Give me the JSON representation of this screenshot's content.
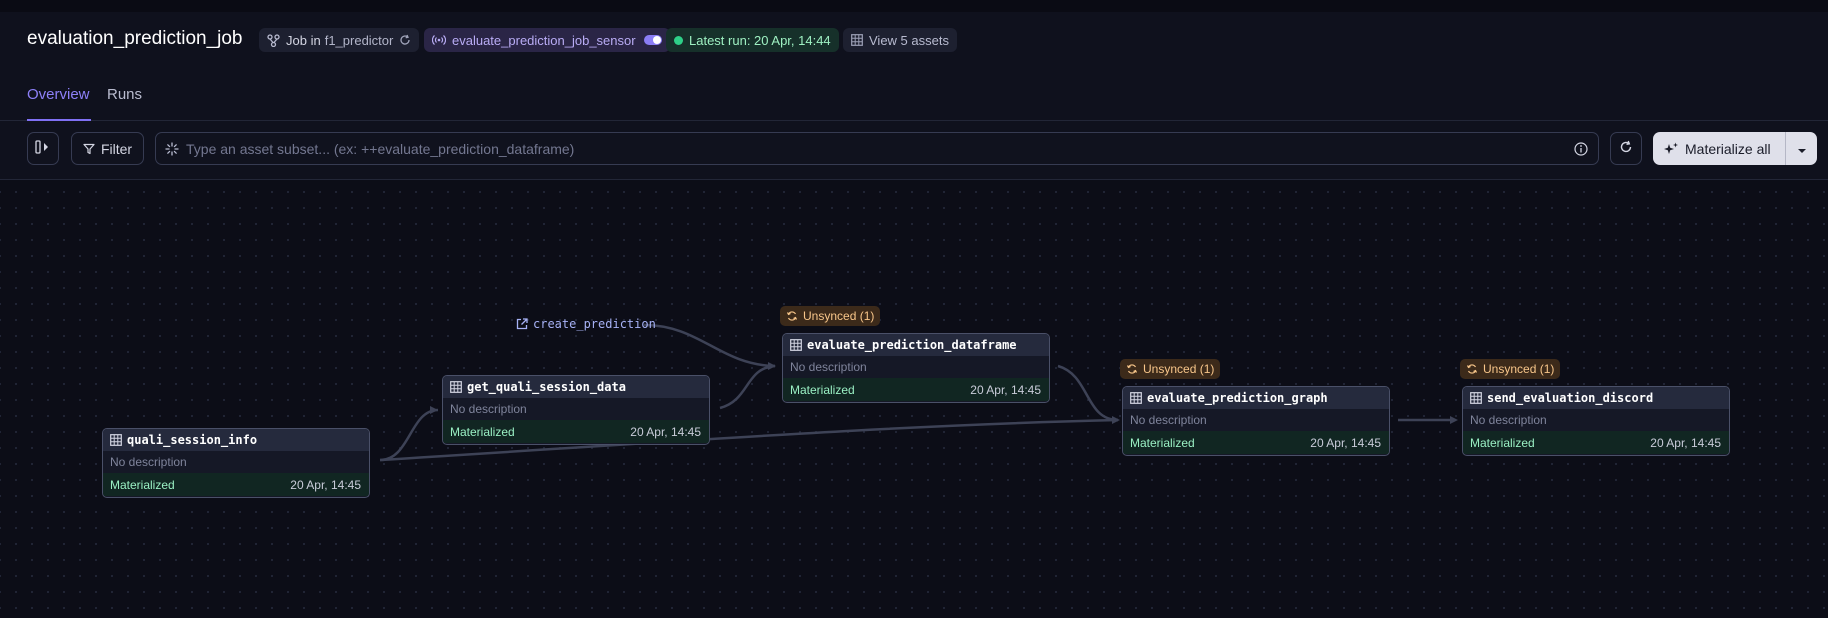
{
  "header": {
    "title": "evaluation_prediction_job",
    "job_prefix": "Job in",
    "job_location": "f1_predictor",
    "sensor_name": "evaluate_prediction_job_sensor",
    "latest_run": "Latest run: 20 Apr, 14:44",
    "view_assets": "View 5 assets"
  },
  "tabs": [
    {
      "label": "Overview",
      "active": true
    },
    {
      "label": "Runs",
      "active": false
    }
  ],
  "toolbar": {
    "filter_label": "Filter",
    "search_placeholder": "Type an asset subset... (ex: ++evaluate_prediction_dataframe)",
    "materialize_label": "Materialize all"
  },
  "graph": {
    "external_link": "create_prediction",
    "nodes": [
      {
        "name": "quali_session_info",
        "description": "No description",
        "status": "Materialized",
        "timestamp": "20 Apr, 14:45",
        "badge": ""
      },
      {
        "name": "get_quali_session_data",
        "description": "No description",
        "status": "Materialized",
        "timestamp": "20 Apr, 14:45",
        "badge": ""
      },
      {
        "name": "evaluate_prediction_dataframe",
        "description": "No description",
        "status": "Materialized",
        "timestamp": "20 Apr, 14:45",
        "badge": "Unsynced (1)"
      },
      {
        "name": "evaluate_prediction_graph",
        "description": "No description",
        "status": "Materialized",
        "timestamp": "20 Apr, 14:45",
        "badge": "Unsynced (1)"
      },
      {
        "name": "send_evaluation_discord",
        "description": "No description",
        "status": "Materialized",
        "timestamp": "20 Apr, 14:45",
        "badge": "Unsynced (1)"
      }
    ]
  },
  "colors": {
    "background": "#0c0d17",
    "accent": "#7f70f3",
    "materialized": "#9af0c4",
    "unsynced": "#f8c68a"
  }
}
